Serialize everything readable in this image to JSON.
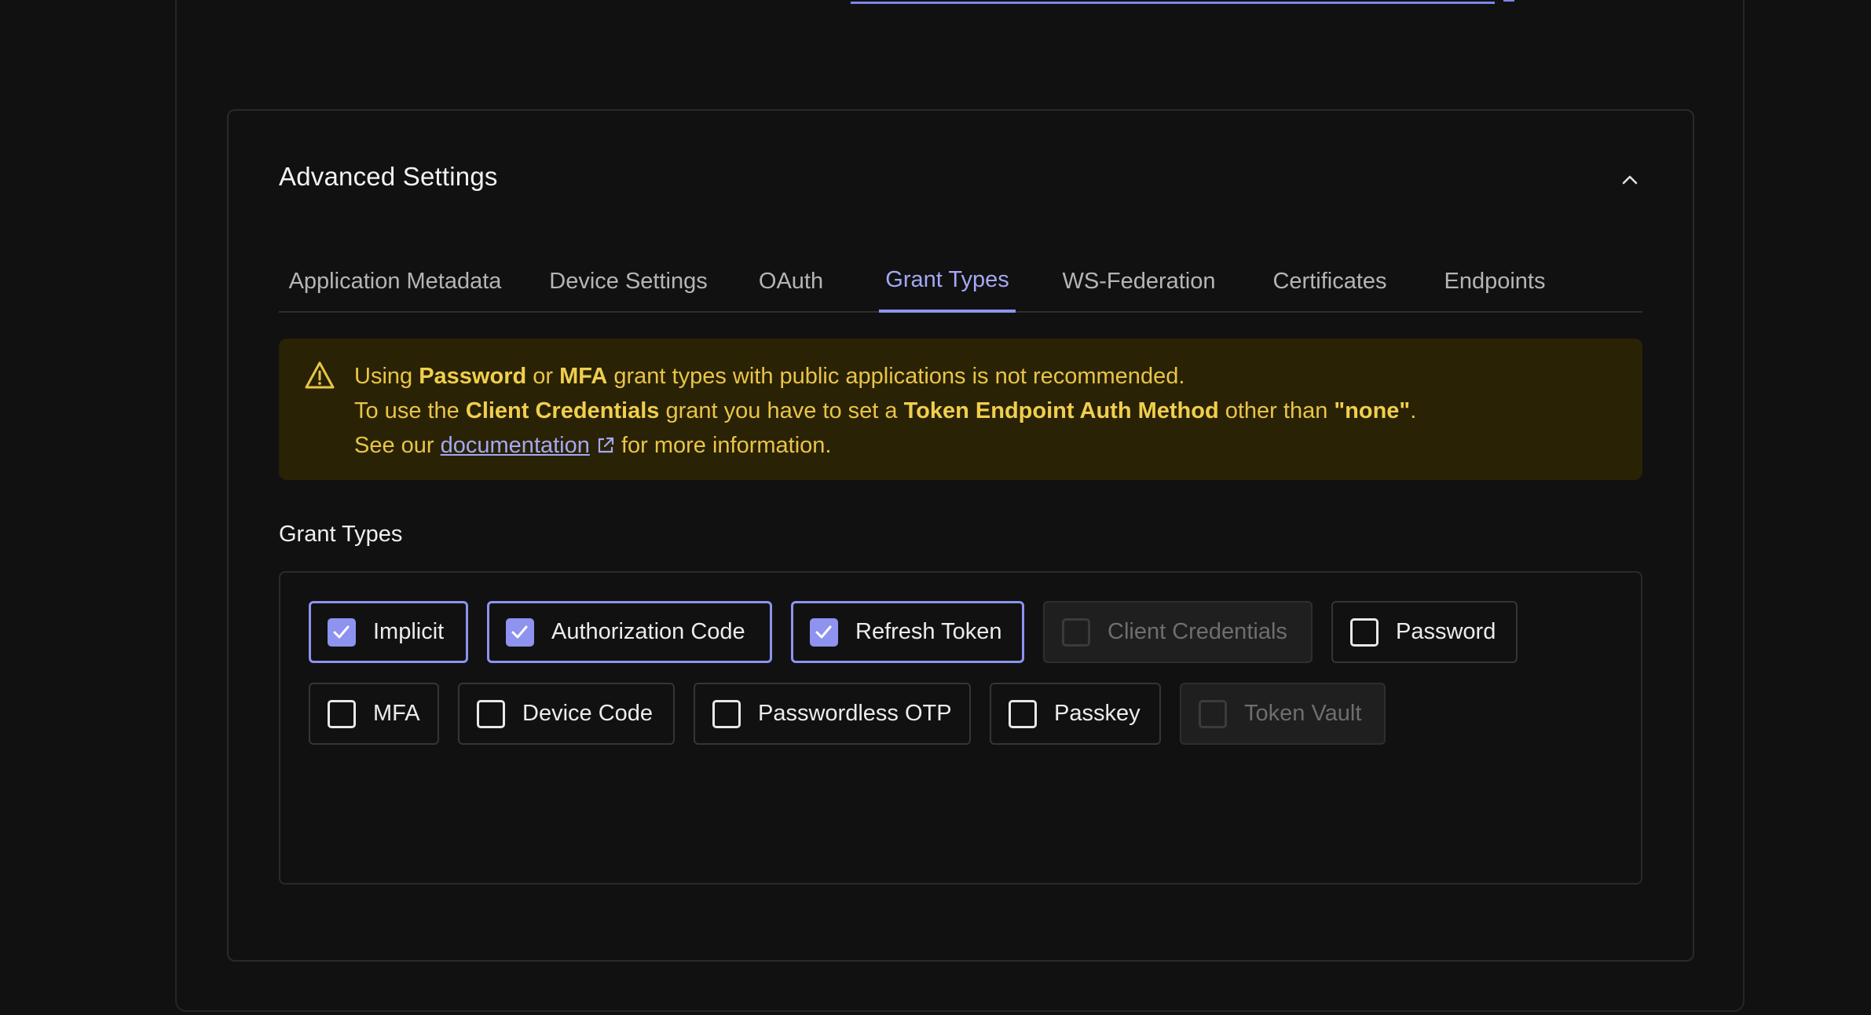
{
  "colors": {
    "background": "#111111",
    "accent": "#8d93ee",
    "warning_bg": "#2a2204",
    "warning_text": "#e8c549"
  },
  "card": {
    "title": "Advanced Settings",
    "collapse_icon": "chevron-up-icon"
  },
  "tabs": [
    {
      "label": "Application Metadata",
      "active": false
    },
    {
      "label": "Device Settings",
      "active": false
    },
    {
      "label": "OAuth",
      "active": false
    },
    {
      "label": "Grant Types",
      "active": true
    },
    {
      "label": "WS-Federation",
      "active": false
    },
    {
      "label": "Certificates",
      "active": false
    },
    {
      "label": "Endpoints",
      "active": false
    }
  ],
  "alert": {
    "icon": "warning-triangle-icon",
    "line1": {
      "t1": "Using ",
      "b1": "Password",
      "t2": " or ",
      "b2": "MFA",
      "t3": " grant types with public applications is not recommended."
    },
    "line2": {
      "t1": "To use the ",
      "b1": "Client Credentials",
      "t2": " grant you have to set a ",
      "b2": "Token Endpoint Auth Method",
      "t3": " other than ",
      "b3": "\"none\"",
      "t4": "."
    },
    "line3": {
      "t1": "See our ",
      "link": "documentation",
      "t2": " for more information."
    },
    "link_icon": "external-link-icon"
  },
  "grant_types": {
    "label": "Grant Types",
    "options": [
      {
        "label": "Implicit",
        "checked": true,
        "disabled": false
      },
      {
        "label": "Authorization Code",
        "checked": true,
        "disabled": false
      },
      {
        "label": "Refresh Token",
        "checked": true,
        "disabled": false
      },
      {
        "label": "Client Credentials",
        "checked": false,
        "disabled": true
      },
      {
        "label": "Password",
        "checked": false,
        "disabled": false
      },
      {
        "label": "MFA",
        "checked": false,
        "disabled": false
      },
      {
        "label": "Device Code",
        "checked": false,
        "disabled": false
      },
      {
        "label": "Passwordless OTP",
        "checked": false,
        "disabled": false
      },
      {
        "label": "Passkey",
        "checked": false,
        "disabled": false
      },
      {
        "label": "Token Vault",
        "checked": false,
        "disabled": true
      }
    ]
  }
}
